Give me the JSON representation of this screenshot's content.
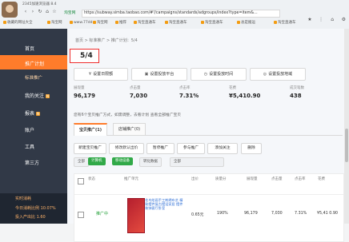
{
  "browser": {
    "title": "2345加速浏览器 8.4",
    "secure": "淘宝网",
    "url": "https://subway.simba.taobao.com/#!/campaigns/standards/adgroups/index?type=item&...",
    "bookmarks": [
      "收藏的网址大全",
      "淘宝网",
      "www.77dd",
      "淘宝网",
      "推荐",
      "淘宝直通车",
      "淘宝直通车",
      "淘宝直通车",
      "总是搬运",
      "淘宝直通车"
    ],
    "top_actions": [
      "★",
      "⋮",
      "⌂",
      "⚙"
    ]
  },
  "sidebar": {
    "items": [
      {
        "label": "首页",
        "icon": "home-icon"
      },
      {
        "label": "推广计划",
        "icon": "campaign-icon"
      },
      {
        "label": "标准推广",
        "icon": ""
      },
      {
        "label": "我的关注",
        "icon": "star-icon",
        "badge": "N"
      },
      {
        "label": "报表",
        "icon": "report-icon",
        "badge": "N"
      },
      {
        "label": "账户",
        "icon": "user-icon"
      },
      {
        "label": "工具",
        "icon": "tool-icon"
      },
      {
        "label": "第三方",
        "icon": "third-party-icon"
      }
    ],
    "bottom": [
      "实时消耗",
      "今日消耗比例 10.07%",
      "投入产出比 1.60"
    ]
  },
  "content": {
    "breadcrumb": "首页 > 标准推广 > 推广计划：5/4",
    "page": "5/4",
    "settings": [
      "设置日限额",
      "设置投放平台",
      "设置投放时间",
      "设置投放地域"
    ],
    "stats": [
      {
        "label": "展现量",
        "value": "96,179"
      },
      {
        "label": "点击量",
        "value": "7,030"
      },
      {
        "label": "点击率",
        "value": "7.31%"
      },
      {
        "label": "花费",
        "value": "¥5,410.90"
      },
      {
        "label": "成交笔数",
        "value": "438"
      }
    ],
    "notice": "您有6个宝贝推广方式，如需调整，去看计划 查看全部推广宝贝",
    "tabs": [
      "宝贝推广(1)",
      "店铺推广(0)"
    ],
    "actions": [
      "新建宝贝推广",
      "修改默认出价",
      "暂停推广",
      "参与推广",
      "添加关注",
      "删除"
    ],
    "filters": [
      "全部",
      "计算机",
      "移动设备",
      "转化数据",
      "全部"
    ],
    "table": {
      "headers": [
        "状态",
        "推广单元",
        "出价",
        "质量分",
        "展现量",
        "点击量",
        "点击率",
        "花费"
      ],
      "row": {
        "status": "推广中",
        "title": "花鸟绘画手工刺绣布艺 精致摆件复古摆设家居 摆件装饰客厅卧室",
        "bid": "0.65元",
        "quality": "190%",
        "impressions": "96,179",
        "clicks": "7,030",
        "ctr": "7.31%",
        "cost": "¥5,41 0.90"
      }
    }
  }
}
